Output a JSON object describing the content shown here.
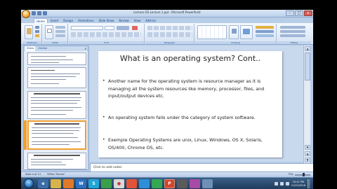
{
  "window": {
    "title": "Lecture-OS Lecture 1.ppt - Microsoft PowerPoint"
  },
  "ribbon": {
    "tabs": [
      "Home",
      "Insert",
      "Design",
      "Animations",
      "Slide Show",
      "Review",
      "View",
      "Add-Ins"
    ],
    "active_tab": "Home",
    "groups": [
      "Clipboard",
      "Slides",
      "Font",
      "Paragraph",
      "Drawing",
      "Editing"
    ]
  },
  "slides_pane": {
    "tabs": [
      "Slides",
      "Outline"
    ],
    "thumbnail_numbers": [
      "",
      "2",
      "3",
      "4",
      "5"
    ],
    "selected_index": 3
  },
  "slide": {
    "title": "What is an operating system? Cont..",
    "bullets": [
      {
        "id": "b1",
        "text": "Another name for the operating system is resource manager as it is managing all the system resources like memory, processor, files, and input/output devices etc."
      },
      {
        "id": "b2",
        "text": "An operating system falls under the category of system software."
      },
      {
        "id": "b3",
        "text": "Exemple Operating Systems are unix, Linux, Windows, OS X, Solaris, OS/400, Chrome OS, etc."
      }
    ],
    "number": "4"
  },
  "notes": {
    "placeholder": "Click to add notes"
  },
  "statusbar": {
    "slide_info": "Slide 4 of 13",
    "theme": "\"Office Theme\"",
    "zoom": "75%"
  },
  "taskbar": {
    "clock_time": "10:41 PM",
    "clock_date": "11/21/2016"
  },
  "colors": {
    "accent": "#f0a030",
    "ribbon_text": "#15428b",
    "taskbar": "#1f3c5c"
  }
}
